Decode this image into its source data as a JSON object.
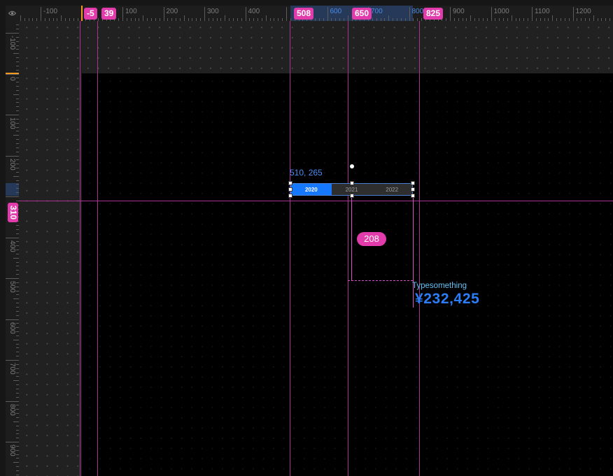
{
  "rulers": {
    "corner_icon": "eye-icon",
    "top": {
      "labels": [
        "-100",
        "100",
        "200",
        "300",
        "400",
        "600",
        "700",
        "800",
        "900",
        "1000",
        "1100",
        "1200"
      ]
    },
    "left": {
      "labels": [
        "-100",
        "0",
        "100",
        "200",
        "400",
        "500",
        "600",
        "700",
        "800",
        "900"
      ]
    }
  },
  "guides": {
    "vertical": [
      "-5",
      "39",
      "508",
      "650",
      "825"
    ],
    "horizontal": [
      "310"
    ]
  },
  "selection": {
    "position": "510, 265",
    "distance": "208"
  },
  "tabs": {
    "items": [
      {
        "label": "2020",
        "active": true
      },
      {
        "label": "2021",
        "active": false
      },
      {
        "label": "2022",
        "active": false
      }
    ]
  },
  "number_card": {
    "title": "Typesomething",
    "value": "¥232,425"
  },
  "colors": {
    "guide_line": "#a8328f",
    "guide_badge": "#e23bab",
    "measure_line": "#d94fc8",
    "selection_readout": "#4d8df6",
    "tab_active": "#1677ff",
    "tab_inactive": "#2e2e2e",
    "ruler_highlight": "#3a7ae0",
    "number_title": "#63c2f5",
    "number_value": "#2b7ef8",
    "origin_marker": "#f29a1f"
  }
}
